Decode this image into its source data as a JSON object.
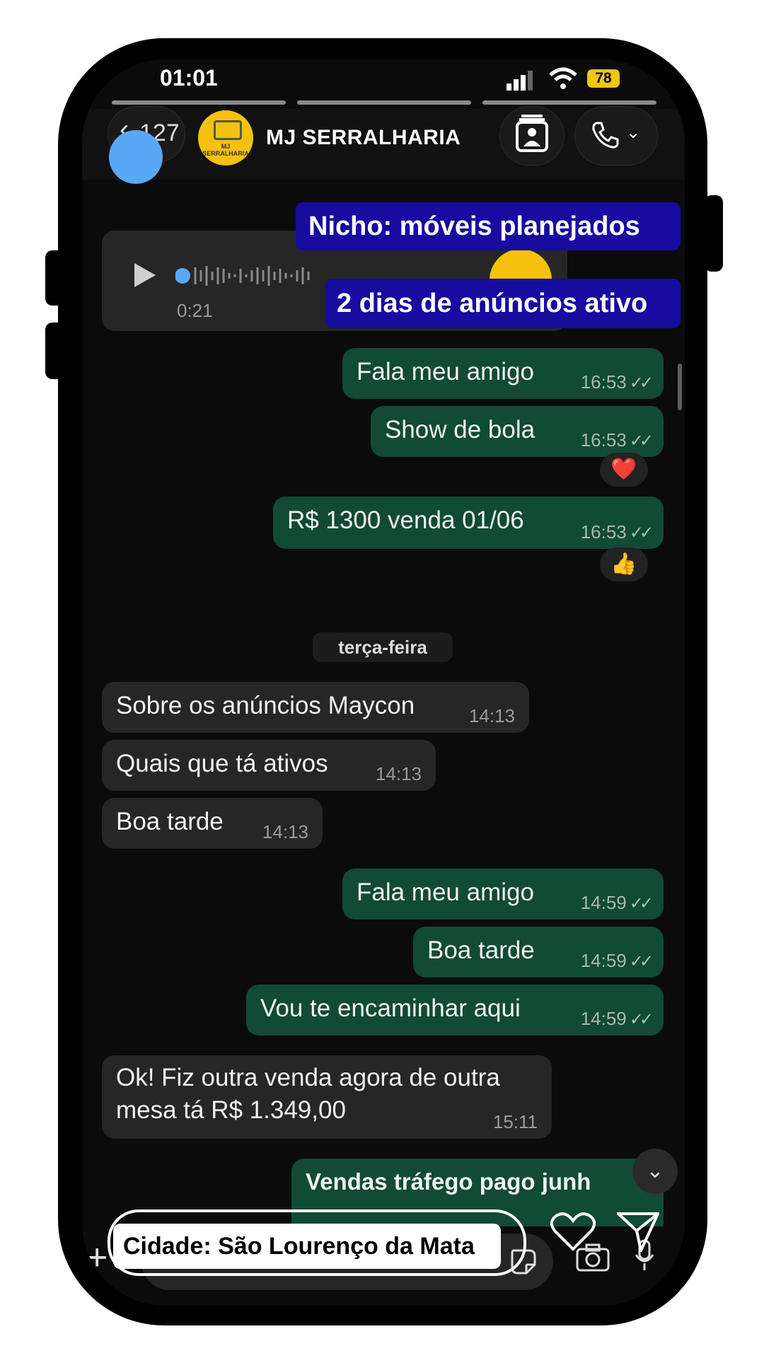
{
  "status_bar": {
    "time": "01:01",
    "battery": "78"
  },
  "header": {
    "back_count": "127",
    "chat_name": "MJ SERRALHARIA",
    "avatar_text": "MJ SERRALHARIA"
  },
  "voice_message": {
    "duration": "0:21"
  },
  "overlays": {
    "niche": "Nicho: móveis planejados",
    "ads_days": "2 dias de anúncios ativo",
    "city": "Cidade: São Lourenço da Mata"
  },
  "messages": [
    {
      "text": "Fala meu amigo",
      "time": "16:53",
      "direction": "out"
    },
    {
      "text": "Show de bola",
      "time": "16:53",
      "direction": "out",
      "reaction": "❤️"
    },
    {
      "text": "R$ 1300 venda 01/06",
      "time": "16:53",
      "direction": "out",
      "reaction": "👍"
    },
    {
      "text": "Sobre os anúncios Maycon",
      "time": "14:13",
      "direction": "in"
    },
    {
      "text": "Quais que tá ativos",
      "time": "14:13",
      "direction": "in"
    },
    {
      "text": "Boa tarde",
      "time": "14:13",
      "direction": "in"
    },
    {
      "text": "Fala meu amigo",
      "time": "14:59",
      "direction": "out"
    },
    {
      "text": "Boa tarde",
      "time": "14:59",
      "direction": "out"
    },
    {
      "text": "Vou te encaminhar aqui",
      "time": "14:59",
      "direction": "out"
    },
    {
      "text_line1": "Ok! Fiz outra venda agora de outra",
      "text_line2": "mesa tá R$ 1.349,00",
      "time": "15:11",
      "direction": "in"
    },
    {
      "text": "Vendas tráfego pago junh",
      "direction": "out"
    }
  ],
  "day_separator": "terça-feira",
  "colors": {
    "outgoing": "#114a35",
    "incoming": "#262626",
    "overlay": "#170ba0",
    "accent_dot": "#59a8f7"
  },
  "icons": [
    "back-chevron-icon",
    "contact-card-icon",
    "phone-icon",
    "play-icon",
    "sticker-icon",
    "camera-icon",
    "mic-icon",
    "heart-icon",
    "send-icon",
    "plus-icon",
    "chevron-down-icon"
  ]
}
